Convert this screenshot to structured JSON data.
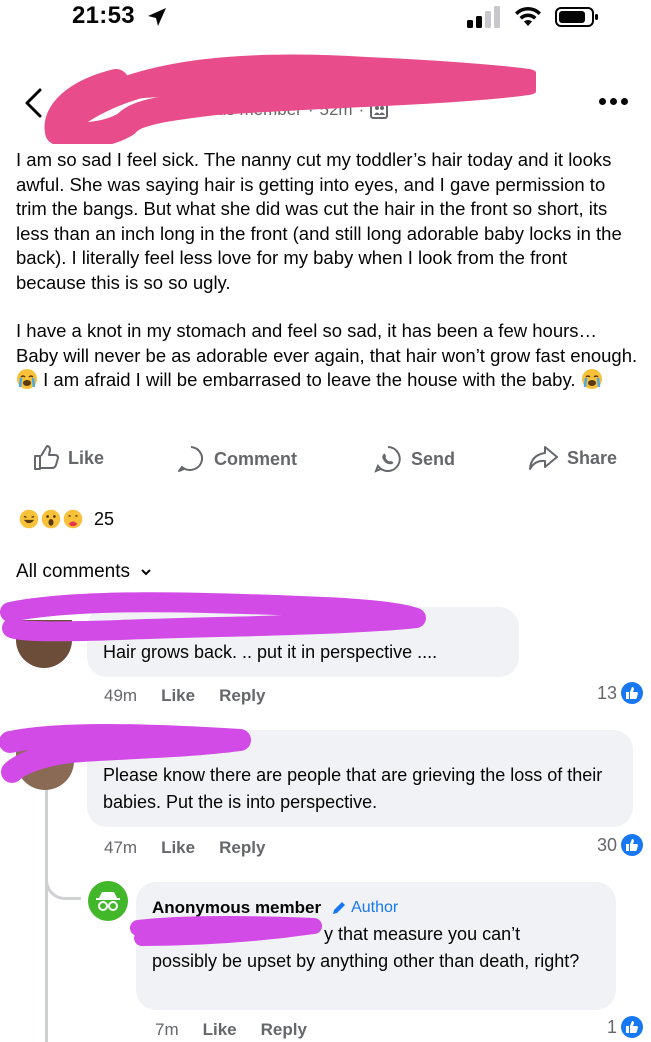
{
  "status_bar": {
    "time": "21:53"
  },
  "post": {
    "author_meta": "Anonymous member",
    "time_ago": "52m",
    "paragraphs": [
      "I am so sad I feel sick. The nanny cut my toddler’s hair today and it looks awful. She was saying hair is getting into eyes, and I gave permission to trim the bangs. But what she did was cut the hair in the front so short, its less than an inch long in the front (and still long adorable baby locks in the back). I literally feel less love for my baby when I look from the front because this is so so ugly.",
      "I have a knot in my stomach and feel so sad, it has been a few hours… Baby will never be as adorable ever again, that hair won’t grow fast enough.",
      "I am afraid I will be embarrased to leave the house with the baby."
    ],
    "reaction_count": "25"
  },
  "actions": {
    "like": "Like",
    "comment": "Comment",
    "send": "Send",
    "share": "Share"
  },
  "comments_header": "All comments",
  "comments": [
    {
      "text": "Hair grows back.  .. put it in perspective ....",
      "time": "49m",
      "like": "Like",
      "reply": "Reply",
      "likes": "13"
    },
    {
      "text": "Please know there are people that are grieving the loss of their babies. Put the is into perspective.",
      "time": "47m",
      "like": "Like",
      "reply": "Reply",
      "likes": "30"
    }
  ],
  "reply": {
    "name": "Anonymous member",
    "tag": "Author",
    "text_line1": "y that measure you can’t",
    "text_rest": "possibly be upset by anything other than death, right?",
    "time": "7m",
    "like": "Like",
    "reply": "Reply",
    "likes": "1"
  },
  "colors": {
    "accent": "#1877f2",
    "muted": "#65676b",
    "bubble": "#f0f2f5",
    "redaction_pink": "#e84c8b",
    "redaction_magenta": "#d24be6"
  },
  "icons": [
    "location-arrow-icon",
    "signal-icon",
    "wifi-icon",
    "battery-icon",
    "back-chevron-icon",
    "group-icon",
    "like-icon",
    "comment-icon",
    "send-icon",
    "share-icon",
    "crying-emoji-icon",
    "incognito-icon",
    "pencil-icon",
    "thumbs-up-badge-icon"
  ]
}
